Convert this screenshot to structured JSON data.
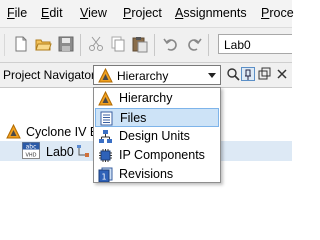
{
  "menubar": {
    "items": [
      {
        "label": "File",
        "mnemonic_index": 0
      },
      {
        "label": "Edit",
        "mnemonic_index": 0
      },
      {
        "label": "View",
        "mnemonic_index": 0
      },
      {
        "label": "Project",
        "mnemonic_index": 0
      },
      {
        "label": "Assignments",
        "mnemonic_index": 0
      },
      {
        "label": "Proce",
        "mnemonic_index": 0
      }
    ]
  },
  "toolbar": {
    "icons": [
      "new-file-icon",
      "open-folder-icon",
      "save-icon",
      "cut-icon",
      "copy-icon",
      "paste-icon",
      "undo-icon",
      "redo-icon",
      "entity-icon"
    ],
    "entity_value": "Lab0"
  },
  "navigator": {
    "title": "Project Navigator",
    "selected_view": "Hierarchy",
    "header_buttons": [
      "search-icon",
      "pin-icon",
      "restore-icon"
    ]
  },
  "dropdown": {
    "options": [
      {
        "label": "Hierarchy",
        "icon": "hierarchy-icon",
        "highlighted": false
      },
      {
        "label": "Files",
        "icon": "files-icon",
        "highlighted": true
      },
      {
        "label": "Design Units",
        "icon": "design-units-icon",
        "highlighted": false
      },
      {
        "label": "IP Components",
        "icon": "ip-components-icon",
        "highlighted": false
      },
      {
        "label": "Revisions",
        "icon": "revisions-icon",
        "highlighted": false
      }
    ]
  },
  "tree": {
    "device": "Cyclone IV E",
    "entity": "Lab0",
    "entity_badge": "abc"
  },
  "colors": {
    "accent_orange": "#f0a020",
    "selection_blue": "#cde3f7",
    "selection_border": "#7eb4ea"
  }
}
